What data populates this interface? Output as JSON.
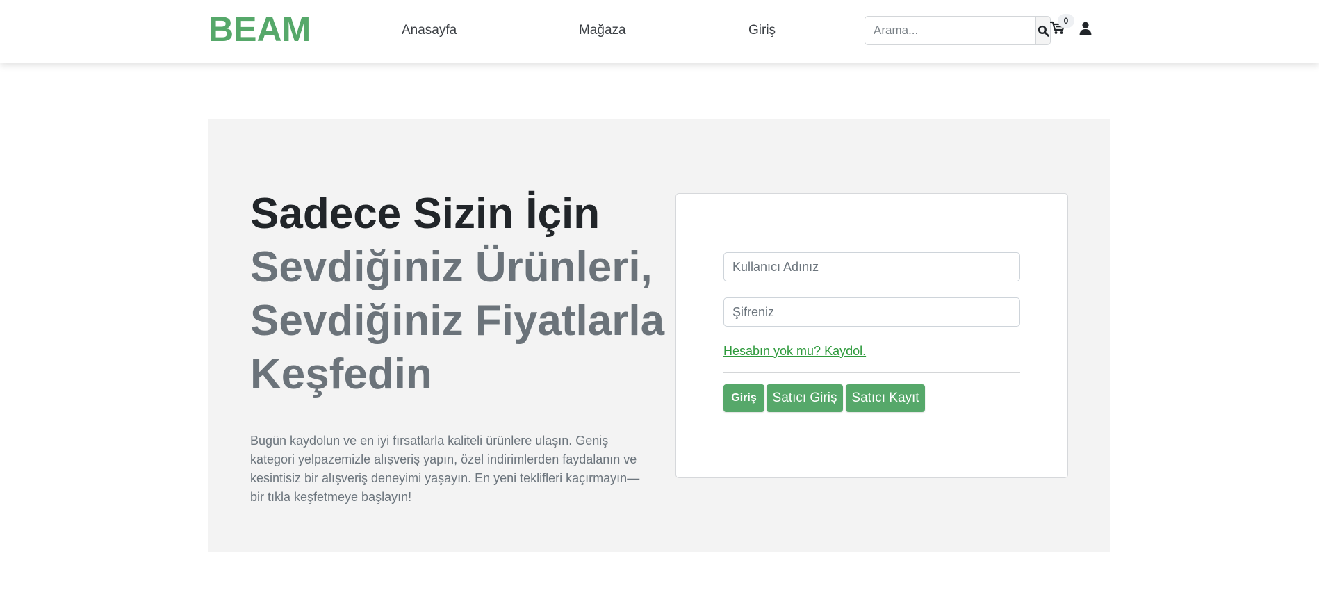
{
  "header": {
    "brand": "BEAM",
    "nav": {
      "home": "Anasayfa",
      "shop": "Mağaza",
      "login": "Giriş"
    },
    "search": {
      "placeholder": "Arama..."
    },
    "cart_count": "0",
    "icons": {
      "search": "search-icon",
      "cart": "cart-icon",
      "user": "user-icon"
    }
  },
  "hero": {
    "headline_line1": "Sadece Sizin İçin",
    "headline_rest": "Sevdiğiniz Ürünleri, Sevdiğiniz Fiyatlarla Keşfedin",
    "lead": "Bugün kaydolun ve en iyi fırsatlarla kaliteli ürünlere ulaşın. Geniş kategori yelpazemizle alışveriş yapın, özel indirimlerden faydalanın ve kesintisiz bir alışveriş deneyimi yaşayın. En yeni teklifleri kaçırmayın—bir tıkla keşfetmeye başlayın!"
  },
  "login_form": {
    "username_placeholder": "Kullanıcı Adınız",
    "password_placeholder": "Şifreniz",
    "signup_link": "Hesabın yok mu? Kaydol.",
    "buttons": {
      "login": "Giriş",
      "seller_login": "Satıcı Giriş",
      "seller_register": "Satıcı Kayıt"
    }
  },
  "colors": {
    "brand": "#56a86a",
    "link": "#2e9a3c",
    "hero_bg": "#f3f3f3",
    "muted_text": "#6b737a"
  }
}
